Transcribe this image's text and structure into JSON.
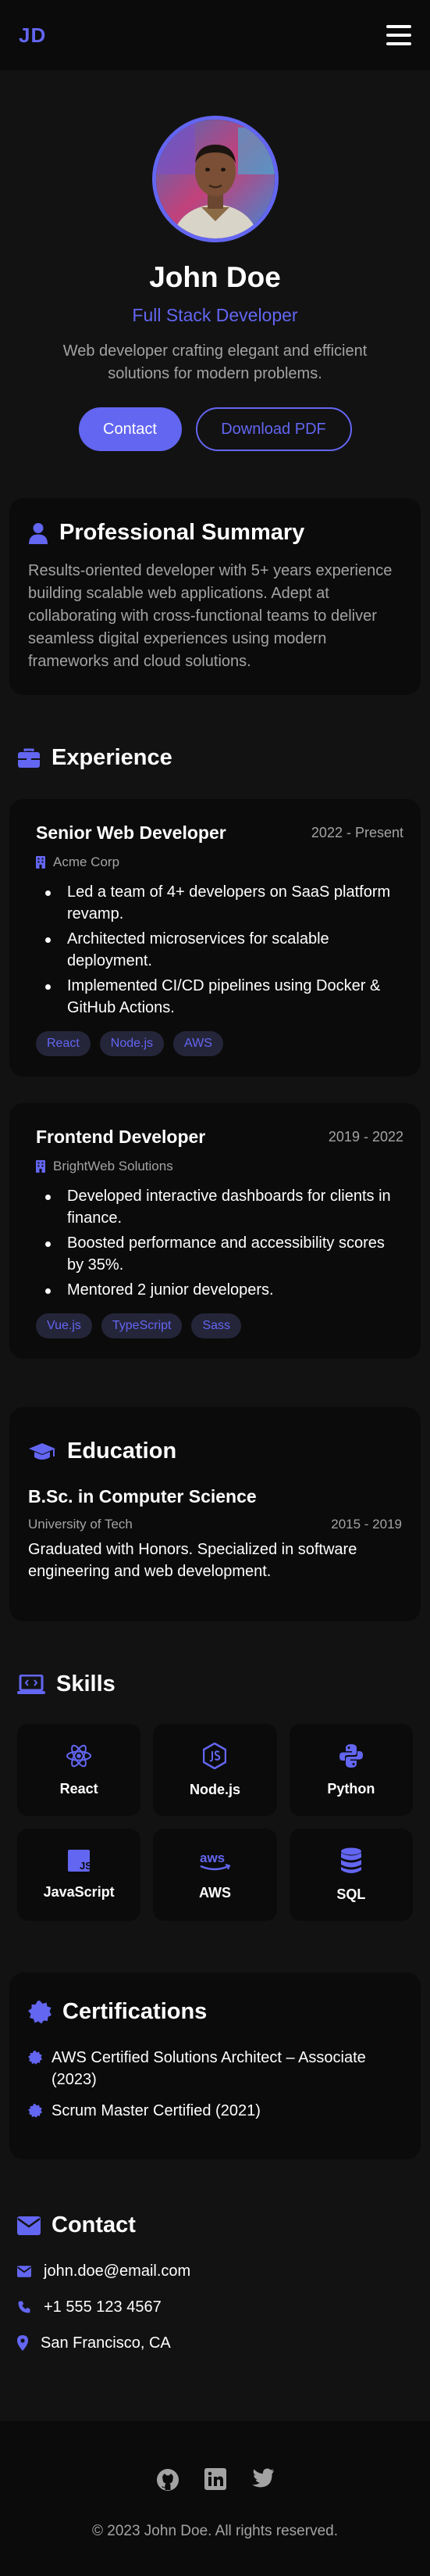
{
  "nav": {
    "logo": "JD"
  },
  "hero": {
    "name": "John Doe",
    "role": "Full Stack Developer",
    "tagline": "Web developer crafting elegant and efficient solutions for modern problems.",
    "contact_label": "Contact",
    "download_label": "Download PDF"
  },
  "summary": {
    "title": "Professional Summary",
    "text": "Results-oriented developer with 5+ years experience building scalable web applications. Adept at collaborating with cross-functional teams to deliver seamless digital experiences using modern frameworks and cloud solutions."
  },
  "experience": {
    "title": "Experience",
    "jobs": [
      {
        "title": "Senior Web Developer",
        "dates": "2022 - Present",
        "company": "Acme Corp",
        "bullets": [
          "Led a team of 4+ developers on SaaS platform revamp.",
          "Architected microservices for scalable deployment.",
          "Implemented CI/CD pipelines using Docker & GitHub Actions."
        ],
        "tags": [
          "React",
          "Node.js",
          "AWS"
        ]
      },
      {
        "title": "Frontend Developer",
        "dates": "2019 - 2022",
        "company": "BrightWeb Solutions",
        "bullets": [
          "Developed interactive dashboards for clients in finance.",
          "Boosted performance and accessibility scores by 35%.",
          "Mentored 2 junior developers."
        ],
        "tags": [
          "Vue.js",
          "TypeScript",
          "Sass"
        ]
      }
    ]
  },
  "education": {
    "title": "Education",
    "degree": "B.Sc. in Computer Science",
    "school": "University of Tech",
    "years": "2015 - 2019",
    "description": "Graduated with Honors. Specialized in software engineering and web development."
  },
  "skills": {
    "title": "Skills",
    "items": [
      {
        "name": "React",
        "icon": "react-icon"
      },
      {
        "name": "Node.js",
        "icon": "nodejs-icon"
      },
      {
        "name": "Python",
        "icon": "python-icon"
      },
      {
        "name": "JavaScript",
        "icon": "javascript-icon"
      },
      {
        "name": "AWS",
        "icon": "aws-icon"
      },
      {
        "name": "SQL",
        "icon": "database-icon"
      }
    ]
  },
  "certifications": {
    "title": "Certifications",
    "items": [
      "AWS Certified Solutions Architect – Associate (2023)",
      "Scrum Master Certified (2021)"
    ]
  },
  "contact": {
    "title": "Contact",
    "email": "john.doe@email.com",
    "phone": "+1 555 123 4567",
    "location": "San Francisco, CA"
  },
  "footer": {
    "socials": [
      "github-icon",
      "linkedin-icon",
      "twitter-icon"
    ],
    "copyright": "© 2023 John Doe. All rights reserved."
  },
  "colors": {
    "accent": "#6366f1",
    "background": "#121212",
    "card": "#0b0b0b",
    "muted": "#a3a3a3"
  }
}
